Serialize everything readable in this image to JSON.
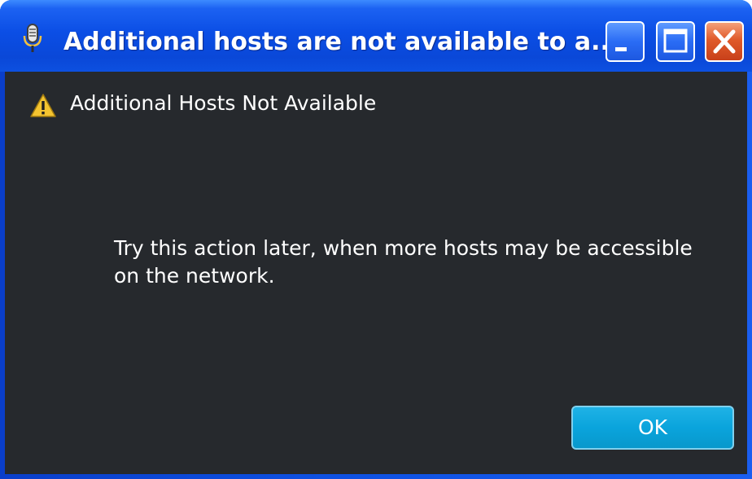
{
  "window": {
    "title": "Additional hosts are not available to a...",
    "app_icon": "microphone-icon",
    "controls": {
      "minimize": "minimize-icon",
      "maximize": "maximize-icon",
      "close": "close-icon"
    }
  },
  "dialog": {
    "heading_icon": "warning-icon",
    "heading": "Additional Hosts Not Available",
    "message": "Try this action later, when more hosts may be accessible on the network.",
    "ok_label": "OK"
  },
  "colors": {
    "titlebar": "#0b4ee5",
    "content_background": "#26292d",
    "ok_button": "#0aa4dc",
    "close_button": "#e05a2a"
  }
}
